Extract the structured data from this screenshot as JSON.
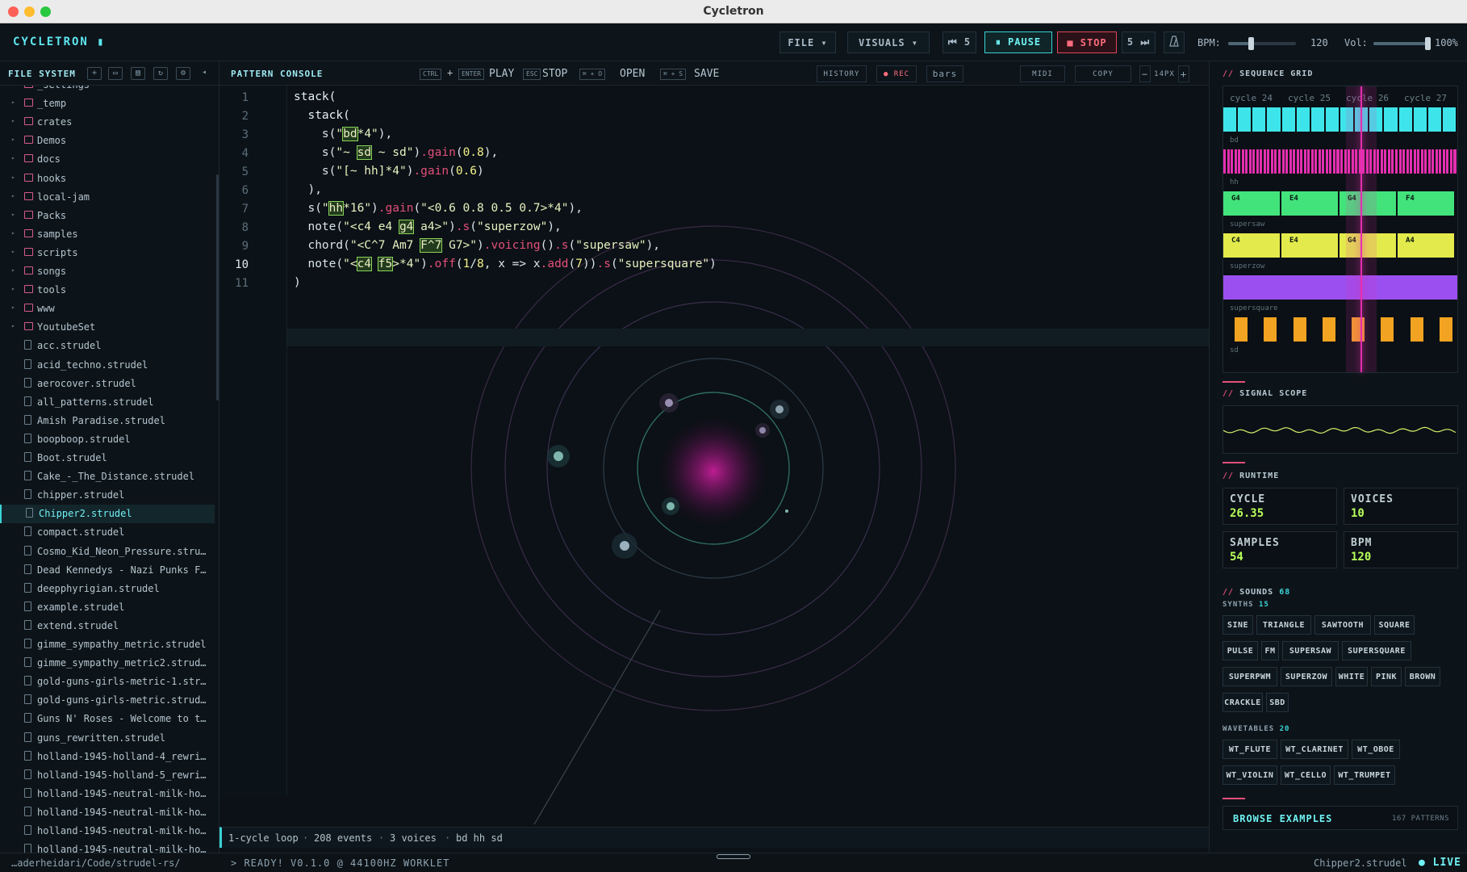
{
  "window": {
    "title": "Cycletron"
  },
  "topbar": {
    "logo": "CYCLETRON ▮",
    "file_menu": "FILE ▾",
    "visuals_menu": "VISUALS ▾",
    "rewind": "⏮ 5",
    "pause": "⏸ PAUSE",
    "stop": "■ STOP",
    "forward": "5 ⏭",
    "metronome_icon": "metronome-icon",
    "bpm_label": "BPM:",
    "bpm_value": "120",
    "bpm_level": 0.35,
    "vol_label": "Vol:",
    "vol_value": "100%",
    "vol_level": 1.0
  },
  "sidebar": {
    "title": "FILE SYSTEM",
    "items": [
      {
        "name": "_settings",
        "type": "folder"
      },
      {
        "name": "_temp",
        "type": "folder"
      },
      {
        "name": "crates",
        "type": "folder"
      },
      {
        "name": "Demos",
        "type": "folder"
      },
      {
        "name": "docs",
        "type": "folder"
      },
      {
        "name": "hooks",
        "type": "folder"
      },
      {
        "name": "local-jam",
        "type": "folder"
      },
      {
        "name": "Packs",
        "type": "folder"
      },
      {
        "name": "samples",
        "type": "folder"
      },
      {
        "name": "scripts",
        "type": "folder"
      },
      {
        "name": "songs",
        "type": "folder"
      },
      {
        "name": "tools",
        "type": "folder"
      },
      {
        "name": "www",
        "type": "folder"
      },
      {
        "name": "YoutubeSet",
        "type": "folder"
      },
      {
        "name": "acc.strudel",
        "type": "file"
      },
      {
        "name": "acid_techno.strudel",
        "type": "file"
      },
      {
        "name": "aerocover.strudel",
        "type": "file"
      },
      {
        "name": "all_patterns.strudel",
        "type": "file"
      },
      {
        "name": "Amish Paradise.strudel",
        "type": "file"
      },
      {
        "name": "boopboop.strudel",
        "type": "file"
      },
      {
        "name": "Boot.strudel",
        "type": "file"
      },
      {
        "name": "Cake_-_The_Distance.strudel",
        "type": "file"
      },
      {
        "name": "chipper.strudel",
        "type": "file"
      },
      {
        "name": "Chipper2.strudel",
        "type": "file",
        "active": true
      },
      {
        "name": "compact.strudel",
        "type": "file"
      },
      {
        "name": "Cosmo_Kid_Neon_Pressure.strudel",
        "type": "file"
      },
      {
        "name": "Dead Kennedys - Nazi Punks F...",
        "type": "file"
      },
      {
        "name": "deepphyrigian.strudel",
        "type": "file"
      },
      {
        "name": "example.strudel",
        "type": "file"
      },
      {
        "name": "extend.strudel",
        "type": "file"
      },
      {
        "name": "gimme_sympathy_metric.strudel",
        "type": "file"
      },
      {
        "name": "gimme_sympathy_metric2.strud...",
        "type": "file"
      },
      {
        "name": "gold-guns-girls-metric-1.str...",
        "type": "file"
      },
      {
        "name": "gold-guns-girls-metric.strud...",
        "type": "file"
      },
      {
        "name": "Guns N' Roses - Welcome to t...",
        "type": "file"
      },
      {
        "name": "guns_rewritten.strudel",
        "type": "file"
      },
      {
        "name": "holland-1945-holland-4_rewri...",
        "type": "file"
      },
      {
        "name": "holland-1945-holland-5_rewri...",
        "type": "file"
      },
      {
        "name": "holland-1945-neutral-milk-ho...",
        "type": "file"
      },
      {
        "name": "holland-1945-neutral-milk-ho...",
        "type": "file"
      },
      {
        "name": "holland-1945-neutral-milk-ho...",
        "type": "file"
      },
      {
        "name": "holland-1945-neutral-milk-ho...",
        "type": "file"
      }
    ]
  },
  "editor": {
    "title": "PATTERN CONSOLE",
    "kbd_ctrl": "CTRL",
    "kbd_plus": "+",
    "kbd_enter": "ENTER",
    "play": "PLAY",
    "kbd_esc": "ESC",
    "stop": "STOP",
    "kbd_open": "⌘ + O",
    "open": "OPEN",
    "kbd_save": "⌘ + S",
    "save": "SAVE",
    "history": "HISTORY",
    "rec": "● REC",
    "bars": "bars",
    "midi": "MIDI",
    "copy": "COPY",
    "font_minus": "−",
    "font_size": "14PX",
    "font_plus": "+",
    "line_numbers": [
      "1",
      "2",
      "3",
      "4",
      "5",
      "6",
      "7",
      "8",
      "9",
      "10",
      "11"
    ],
    "current_line": 10
  },
  "status": {
    "loop": "1-cycle loop",
    "events": "208 events",
    "voices": "3 voices",
    "sounds": "bd hh sd",
    "sep": "·"
  },
  "bottom": {
    "path": "…aderheidari/Code/strudel-rs/",
    "ready": "> READY! V0.1.0 @ 44100HZ WORKLET",
    "file": "Chipper2.strudel",
    "live": "● LIVE"
  },
  "right": {
    "grid_title": "SEQUENCE GRID",
    "cycles": [
      "cycle 24",
      "cycle 25",
      "cycle 26",
      "cycle 27"
    ],
    "tracks": [
      {
        "name": "bd",
        "color": "#3de5ea"
      },
      {
        "name": "hh",
        "color": "#e52fb0"
      },
      {
        "name": "supersaw",
        "color": "#43e37c",
        "notes": [
          "G4",
          "E4",
          "G4",
          "F4"
        ]
      },
      {
        "name": "superzow",
        "color": "#e3ea4b",
        "notes": [
          "C4",
          "E4",
          "G4",
          "A4"
        ]
      },
      {
        "name": "supersquare",
        "color": "#9b4ff0"
      },
      {
        "name": "sd",
        "color": "#f2a321"
      }
    ],
    "scope_title": "SIGNAL SCOPE",
    "runtime_title": "RUNTIME",
    "stats": [
      {
        "key": "CYCLE",
        "value": "26.35"
      },
      {
        "key": "VOICES",
        "value": "10"
      },
      {
        "key": "SAMPLES",
        "value": "54"
      },
      {
        "key": "BPM",
        "value": "120"
      }
    ],
    "sounds_title": "SOUNDS",
    "sounds_count": "68",
    "synths_label": "SYNTHS",
    "synths_count": "15",
    "synths": [
      "SINE",
      "TRIANGLE",
      "SAWTOOTH",
      "SQUARE",
      "PULSE",
      "FM",
      "SUPERSAW",
      "SUPERSQUARE",
      "SUPERPWM",
      "SUPERZOW",
      "WHITE",
      "PINK",
      "BROWN",
      "CRACKLE",
      "SBD"
    ],
    "wavetables_label": "WAVETABLES",
    "wavetables_count": "20",
    "wavetables": [
      "WT_FLUTE",
      "WT_CLARINET",
      "WT_OBOE",
      "WT_VIOLIN",
      "WT_CELLO",
      "WT_TRUMPET"
    ],
    "browse": "BROWSE EXAMPLES",
    "browse_count": "167 PATTERNS"
  }
}
